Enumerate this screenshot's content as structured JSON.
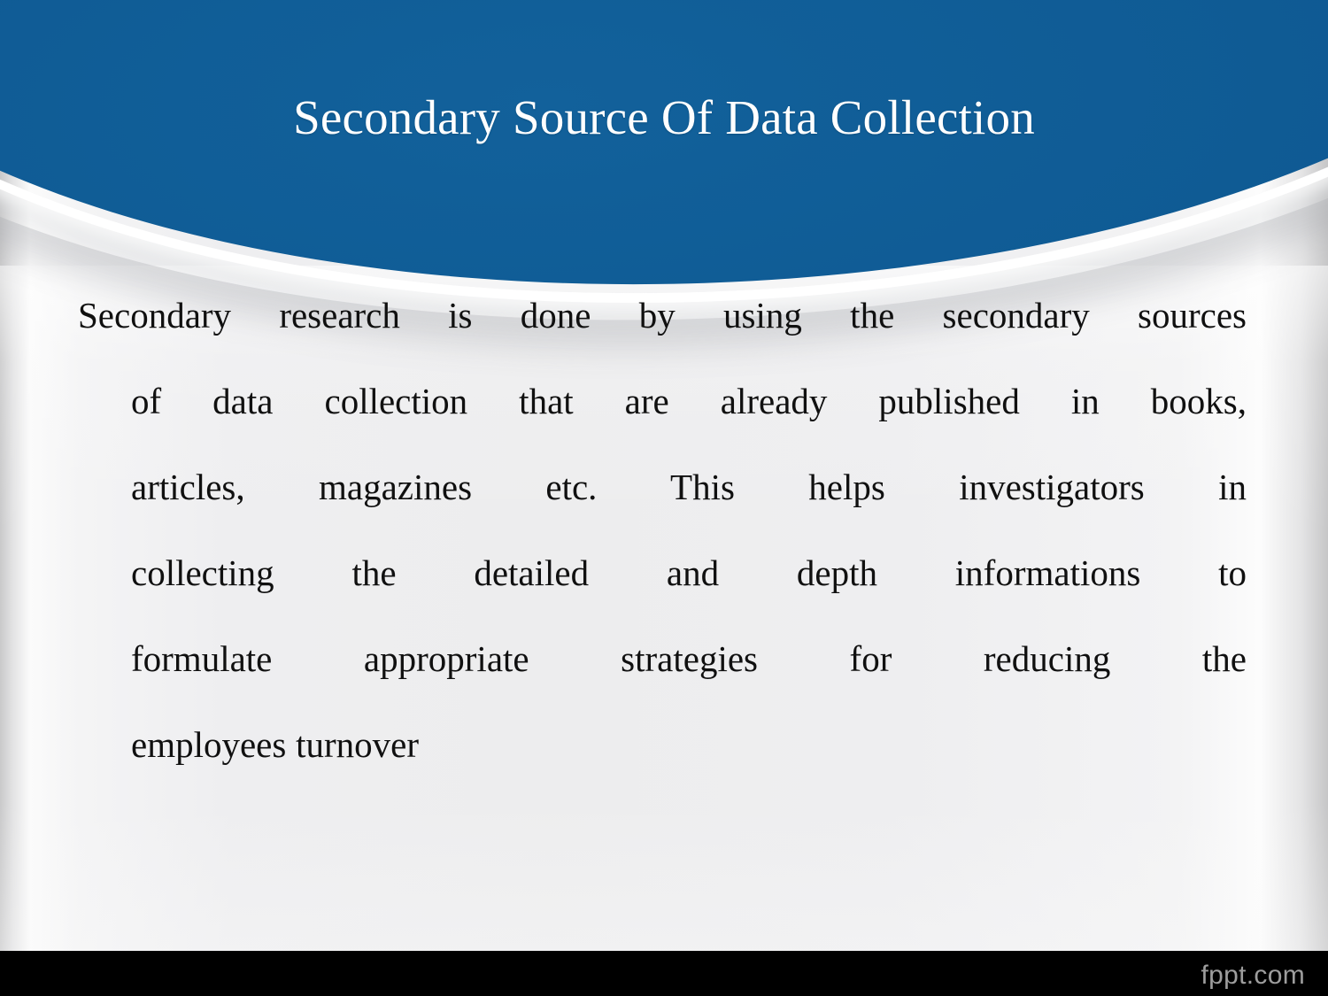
{
  "slide": {
    "title": "Secondary Source Of Data Collection",
    "title_color": "#ffffff",
    "header_color": "#0a5388",
    "body_background_color": "#ededee",
    "body_text_color": "#101010",
    "body_lines": [
      "Secondary research is done by using the secondary sources",
      "of data collection that are already published in books,",
      "articles, magazines etc. This helps investigators in",
      "collecting the detailed and depth informations to",
      "formulate appropriate strategies for reducing the",
      "employees turnover"
    ],
    "body_paragraph": "Secondary research is done by using the secondary sources of data collection that are already published in books, articles, magazines etc. This helps investigators in collecting the detailed and depth informations to formulate appropriate strategies for reducing the employees turnover"
  },
  "footer": {
    "logo_text": "fppt.com",
    "bar_color": "#000000",
    "logo_color": "#9d9d9d"
  }
}
